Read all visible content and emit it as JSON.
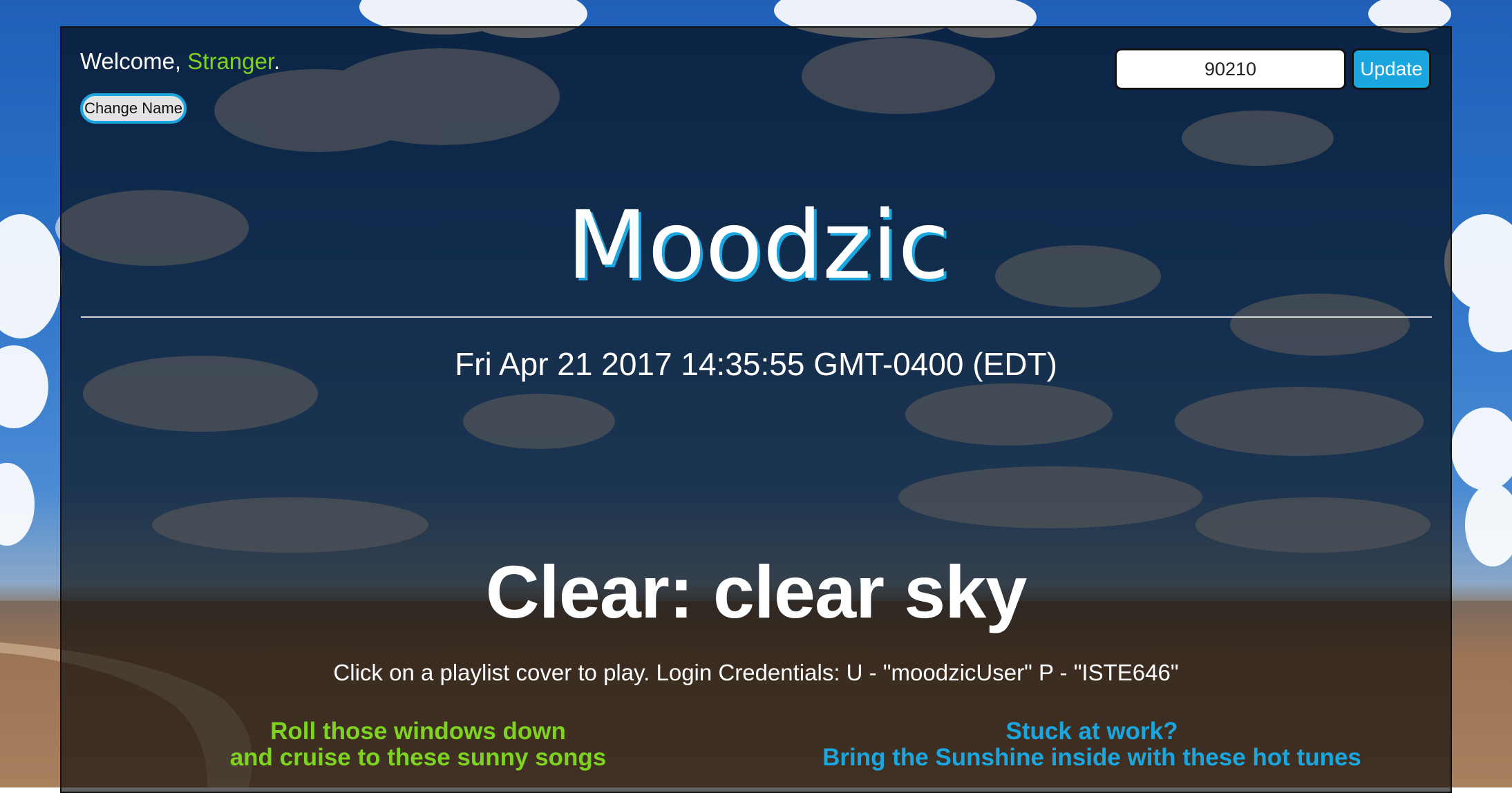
{
  "colors": {
    "accent_green": "#7ed321",
    "accent_blue": "#1aa7e0",
    "text": "#ffffff"
  },
  "header": {
    "welcome_prefix": "Welcome, ",
    "user_name": "Stranger",
    "welcome_suffix": ".",
    "change_name_label": "Change Name",
    "zip_value": "90210",
    "update_label": "Update"
  },
  "logo": {
    "text": "Moodzic"
  },
  "datetime": "Fri Apr 21 2017 14:35:55 GMT-0400 (EDT)",
  "weather": {
    "summary": "Clear: clear sky"
  },
  "instructions": "Click on a playlist cover to play. Login Credentials: U - \"moodzicUser\" P - \"ISTE646\"",
  "playlists": [
    {
      "line1": "Roll those windows down",
      "line2": "and cruise to these sunny songs"
    },
    {
      "line1": "Stuck at work?",
      "line2": "Bring the Sunshine inside with these hot tunes"
    }
  ]
}
